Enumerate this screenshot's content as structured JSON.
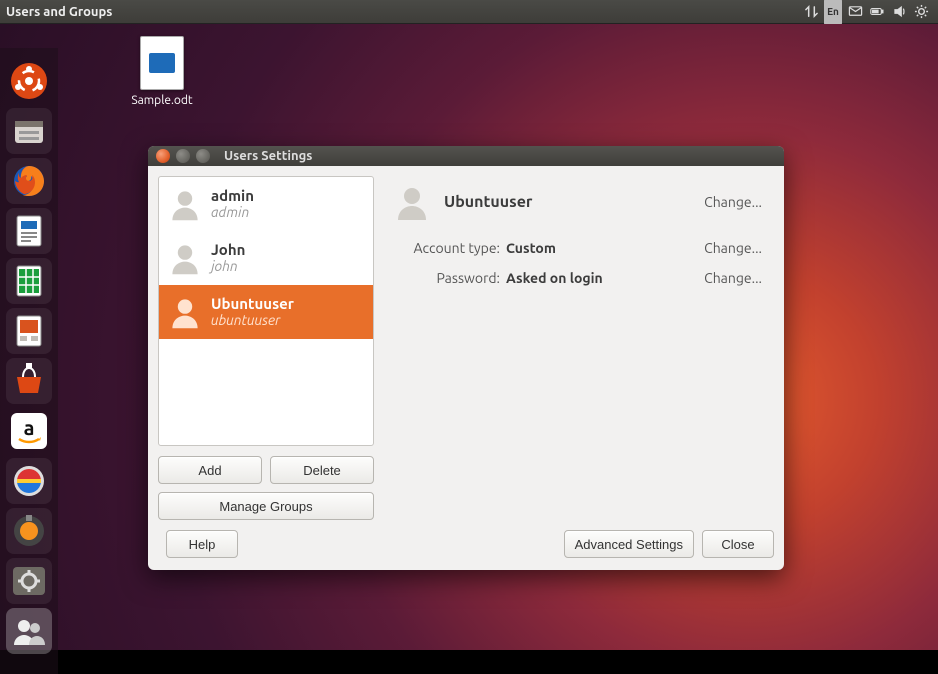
{
  "topbar": {
    "title": "Users and Groups",
    "lang": "En"
  },
  "desktop_file": {
    "name": "Sample.odt"
  },
  "dialog": {
    "title": "Users Settings",
    "users": [
      {
        "full": "admin",
        "login": "admin"
      },
      {
        "full": "John",
        "login": "john"
      },
      {
        "full": "Ubuntuuser",
        "login": "ubuntuuser"
      }
    ],
    "selected_index": 2,
    "detail": {
      "name": "Ubuntuuser",
      "account_type_label": "Account type:",
      "account_type_value": "Custom",
      "password_label": "Password:",
      "password_value": "Asked on login",
      "change": "Change..."
    },
    "buttons": {
      "add": "Add",
      "delete": "Delete",
      "manage_groups": "Manage Groups",
      "help": "Help",
      "advanced": "Advanced Settings",
      "close": "Close"
    }
  }
}
